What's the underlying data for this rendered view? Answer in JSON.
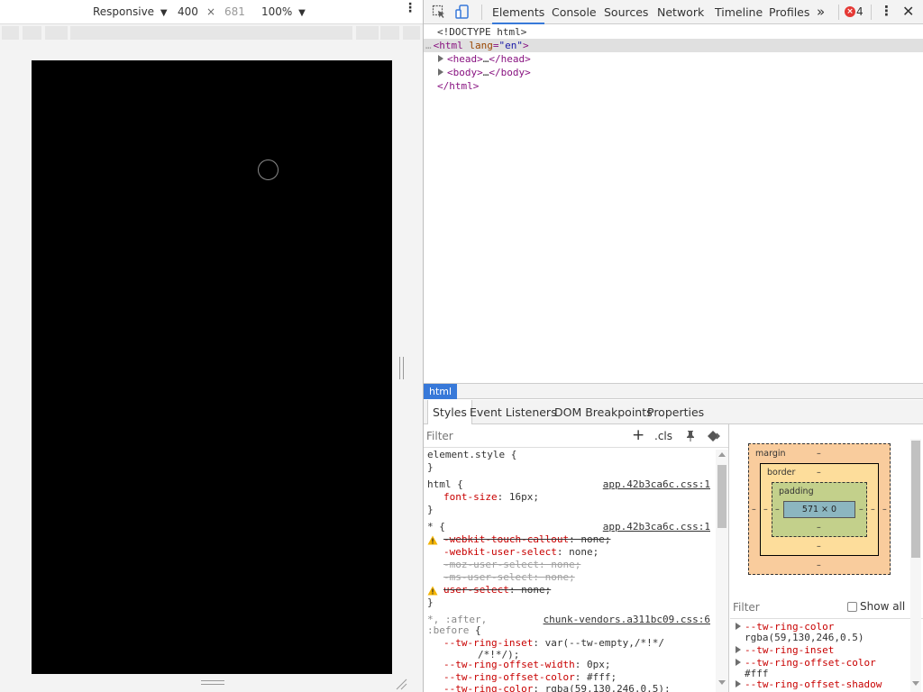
{
  "device_toolbar": {
    "mode": "Responsive",
    "width": "400",
    "times": "×",
    "height": "681",
    "zoom": "100%"
  },
  "devtools": {
    "tabs": [
      {
        "label": "Elements",
        "active": true
      },
      {
        "label": "Console"
      },
      {
        "label": "Sources"
      },
      {
        "label": "Network"
      },
      {
        "label": "Timeline"
      },
      {
        "label": "Profiles"
      }
    ],
    "more_tabs": "»",
    "error_count": "4",
    "dom": {
      "doctype": "<!DOCTYPE html>",
      "html_open_tag": "html",
      "html_attr": "lang",
      "html_attr_value": "\"en\"",
      "head_open": "<head>",
      "head_ellipsis": "…",
      "head_close": "</head>",
      "body_open": "<body>",
      "body_ellipsis": "…",
      "body_close": "</body>",
      "html_close": "</html>"
    },
    "breadcrumb": "html",
    "subtabs": [
      "Styles",
      "Event Listeners",
      "DOM Breakpoints",
      "Properties"
    ],
    "styles_filter_placeholder": "Filter",
    "cls_label": ".cls",
    "styles": {
      "element_style": "element.style {",
      "brace_close": "}",
      "rule1_selector": "html {",
      "rule1_source": "app.42b3ca6c.css:1",
      "rule1_prop": "font-size",
      "rule1_value": "16px;",
      "rule2_selector": "* {",
      "rule2_source": "app.42b3ca6c.css:1",
      "rule2_props": [
        {
          "name": "-webkit-touch-callout",
          "value": "none;",
          "warn": true,
          "struck": true
        },
        {
          "name": "-webkit-user-select",
          "value": "none;",
          "warn": false,
          "struck": false
        },
        {
          "name": "-moz-user-select",
          "value": "none;",
          "warn": false,
          "struck": true,
          "gray": true
        },
        {
          "name": "-ms-user-select",
          "value": "none;",
          "warn": false,
          "struck": true,
          "gray": true
        },
        {
          "name": "user-select",
          "value": "none;",
          "warn": true,
          "struck": true
        }
      ],
      "rule3_selector_a": "*, :after,",
      "rule3_selector_b": ":before {",
      "rule3_source": "chunk-vendors.a311bc09.css:6",
      "rule3_props": [
        {
          "name": "--tw-ring-inset",
          "value": "var(--tw-empty,/*!*/"
        },
        {
          "name": "",
          "value": "/*!*/);"
        },
        {
          "name": "--tw-ring-offset-width",
          "value": "0px;"
        },
        {
          "name": "--tw-ring-offset-color",
          "value": "#fff;"
        },
        {
          "name": "--tw-ring-color",
          "value": "rgba(59,130,246,0.5);"
        }
      ]
    },
    "box_model": {
      "margin_label": "margin",
      "border_label": "border",
      "padding_label": "padding",
      "dash": "–",
      "content": "571 × 0"
    },
    "computed_filter_placeholder": "Filter",
    "show_all_label": "Show all",
    "computed": [
      {
        "name": "--tw-ring-color",
        "value": "rgba(59,130,246,0.5)"
      },
      {
        "name": "--tw-ring-inset",
        "value": ""
      },
      {
        "name": "--tw-ring-offset-color",
        "value": "#fff"
      },
      {
        "name": "--tw-ring-offset-shadow",
        "value": ""
      }
    ]
  }
}
